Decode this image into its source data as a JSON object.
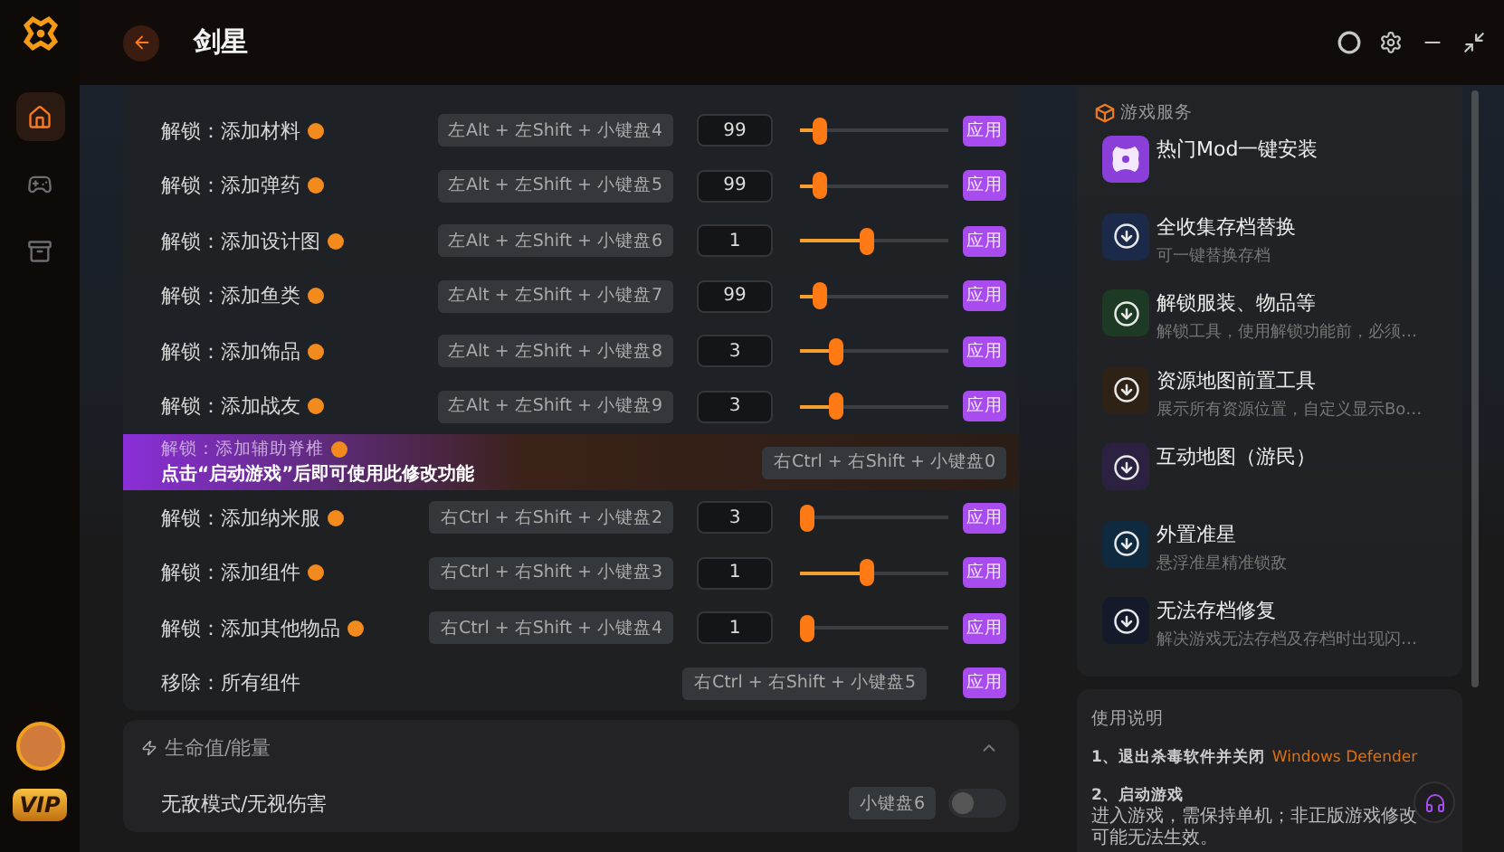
{
  "app": {
    "title": "剑星"
  },
  "sidebar": {
    "nav": [
      {
        "kind": "home",
        "selected": true
      },
      {
        "kind": "gamepad",
        "selected": false
      },
      {
        "kind": "storage",
        "selected": false
      }
    ],
    "vip_badge": "VIP"
  },
  "mods": {
    "rows": [
      {
        "kind": "slider",
        "label": "解锁：添加材料",
        "info": true,
        "hotkey": "左Alt + 左Shift + 小键盘4",
        "value": "99",
        "level": 0.1,
        "action": "应用"
      },
      {
        "kind": "slider",
        "label": "解锁：添加弹药",
        "info": true,
        "hotkey": "左Alt + 左Shift + 小键盘5",
        "value": "99",
        "level": 0.1,
        "action": "应用"
      },
      {
        "kind": "slider",
        "label": "解锁：添加设计图",
        "info": true,
        "hotkey": "左Alt + 左Shift + 小键盘6",
        "value": "1",
        "level": 0.45,
        "action": "应用"
      },
      {
        "kind": "slider",
        "label": "解锁：添加鱼类",
        "info": true,
        "hotkey": "左Alt + 左Shift + 小键盘7",
        "value": "99",
        "level": 0.1,
        "action": "应用"
      },
      {
        "kind": "slider",
        "label": "解锁：添加饰品",
        "info": true,
        "hotkey": "左Alt + 左Shift + 小键盘8",
        "value": "3",
        "level": 0.22,
        "action": "应用"
      },
      {
        "kind": "slider",
        "label": "解锁：添加战友",
        "info": true,
        "hotkey": "左Alt + 左Shift + 小键盘9",
        "value": "3",
        "level": 0.22,
        "action": "应用"
      },
      {
        "kind": "locked",
        "label": "解锁：添加辅助脊椎",
        "info": true,
        "notice": "点击“启动游戏”后即可使用此修改功能",
        "hotkey": "右Ctrl + 右Shift + 小键盘0"
      },
      {
        "kind": "slider",
        "label": "解锁：添加纳米服",
        "info": true,
        "hotkey": "右Ctrl + 右Shift + 小键盘2",
        "value": "3",
        "level": 0,
        "action": "应用"
      },
      {
        "kind": "slider",
        "label": "解锁：添加组件",
        "info": true,
        "hotkey": "右Ctrl + 右Shift + 小键盘3",
        "value": "1",
        "level": 0.45,
        "action": "应用"
      },
      {
        "kind": "slider",
        "label": "解锁：添加其他物品",
        "info": true,
        "hotkey": "右Ctrl + 右Shift + 小键盘4",
        "value": "1",
        "level": 0,
        "action": "应用"
      },
      {
        "kind": "button",
        "label": "移除：所有组件",
        "info": false,
        "hotkey": "右Ctrl + 右Shift + 小键盘5",
        "action": "应用"
      }
    ]
  },
  "health": {
    "title": "生命值/能量",
    "expanded": true,
    "rows": [
      {
        "label": "无敌模式/无视伤害",
        "hotkey": "小键盘6",
        "on": false
      }
    ]
  },
  "services": {
    "title": "游戏服务",
    "items": [
      {
        "kind": "mod",
        "title": "热门Mod一键安装",
        "color": "#8b3fd9"
      },
      {
        "kind": "download",
        "title": "全收集存档替换",
        "subtitle": "可一键替换存档",
        "color": "#1c2a4a"
      },
      {
        "kind": "download",
        "title": "解锁服装、物品等",
        "subtitle": "解锁工具，使用解锁功能前，必须…",
        "color": "#1d3a24"
      },
      {
        "kind": "download",
        "title": "资源地图前置工具",
        "subtitle": "展示所有资源位置，自定义显示Bo…",
        "color": "#2e2216"
      },
      {
        "kind": "download",
        "title": "互动地图（游民）",
        "color": "#2c2140"
      },
      {
        "kind": "download",
        "title": "外置准星",
        "subtitle": "悬浮准星精准锁敌",
        "color": "#0f2a3f"
      },
      {
        "kind": "download",
        "title": "无法存档修复",
        "subtitle": "解决游戏无法存档及存档时出现闪…",
        "color": "#141a2a"
      }
    ]
  },
  "instructions": {
    "title": "使用说明",
    "steps": [
      {
        "title": "1、退出杀毒软件并关闭",
        "link": "Windows Defender"
      },
      {
        "title": "2、启动游戏",
        "body": "进入游戏，需保持单机；非正版游戏修改可能无法生效。"
      }
    ]
  }
}
